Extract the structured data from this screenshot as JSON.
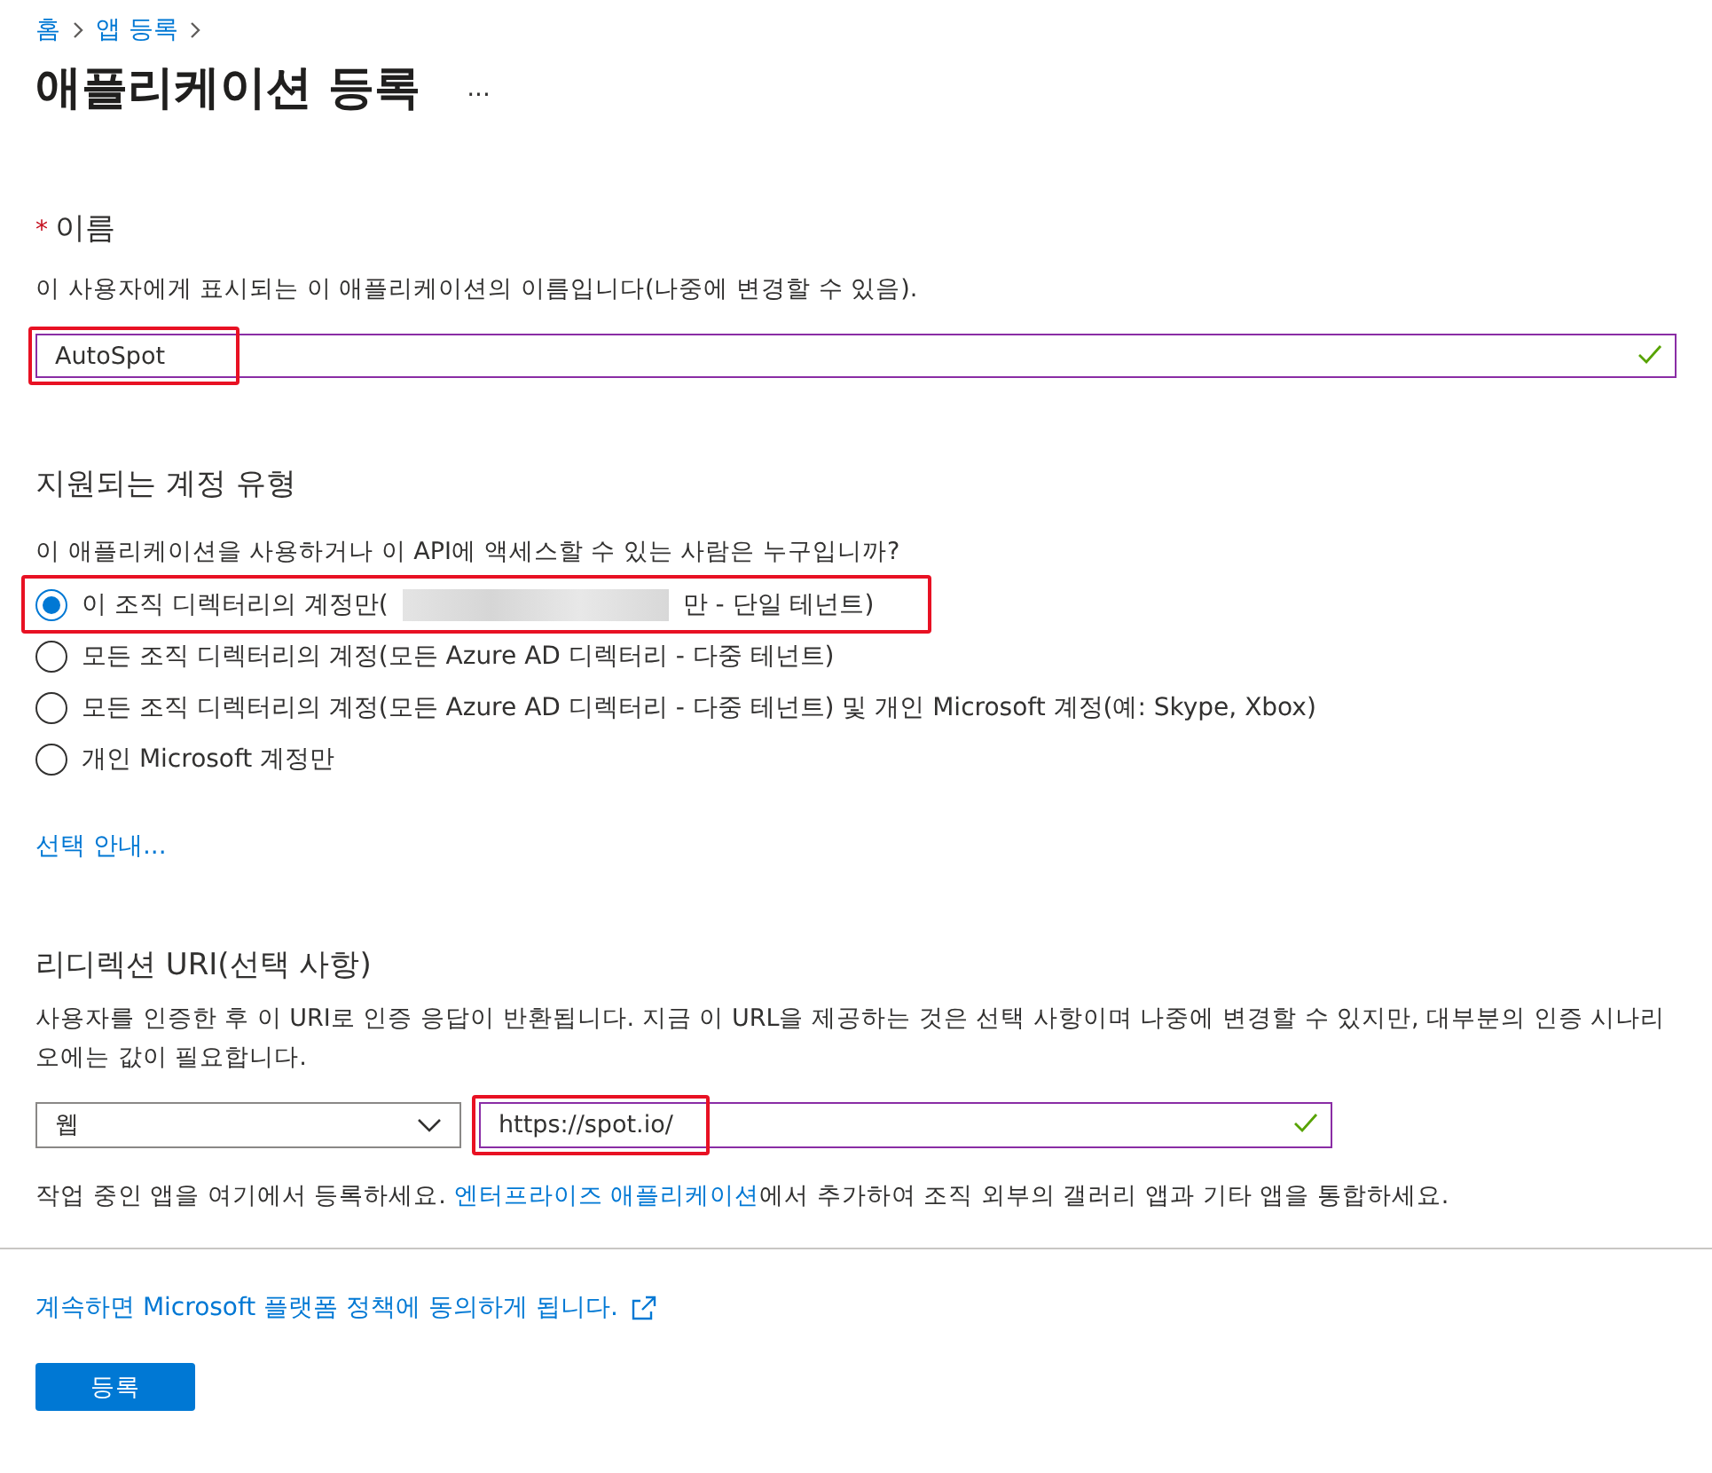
{
  "breadcrumb": [
    "홈",
    "앱 등록"
  ],
  "title": "애플리케이션 등록",
  "more": "...",
  "name_section": {
    "label": "이름",
    "required": true,
    "required_mark": "*",
    "description": "이 사용자에게 표시되는 이 애플리케이션의 이름입니다(나중에 변경할 수 있음).",
    "value": "AutoSpot",
    "valid": true,
    "highlighted": true
  },
  "account_section": {
    "label": "지원되는 계정 유형",
    "question": "이 애플리케이션을 사용하거나 이 API에 액세스할 수 있는 사람은 누구입니까?",
    "options": [
      {
        "label": "이 조직 디렉터리의 계정만(",
        "redacted": true,
        "label_end": "만 - 단일 테넌트)",
        "selected": true,
        "highlighted": true
      },
      {
        "label": "모든 조직 디렉터리의 계정(모든 Azure AD 디렉터리 - 다중 테넌트)",
        "selected": false,
        "highlighted": false
      },
      {
        "label": "모든 조직 디렉터리의 계정(모든 Azure AD 디렉터리 - 다중 테넌트) 및 개인 Microsoft 계정(예: Skype, Xbox)",
        "selected": false,
        "highlighted": false
      },
      {
        "label": "개인 Microsoft 계정만",
        "selected": false,
        "highlighted": false
      }
    ],
    "help_link": "선택 안내..."
  },
  "redirect_section": {
    "label": "리디렉션 URI(선택 사항)",
    "description": "사용자를 인증한 후 이 URI로 인증 응답이 반환됩니다. 지금 이 URL을 제공하는 것은 선택 사항이며 나중에 변경할 수 있지만, 대부분의 인증 시나리오에는 값이 필요합니다.",
    "platform": "웹",
    "uri": "https://spot.io/",
    "valid": true,
    "highlighted": true,
    "note_before": "작업 중인 앱을 여기에서 등록하세요. ",
    "note_link": "엔터프라이즈 애플리케이션",
    "note_after": "에서 추가하여 조직 외부의 갤러리 앱과 기타 앱을 통합하세요."
  },
  "consent_link": "계속하면 Microsoft 플랫폼 정책에 동의하게 됩니다.",
  "register_button": "등록"
}
